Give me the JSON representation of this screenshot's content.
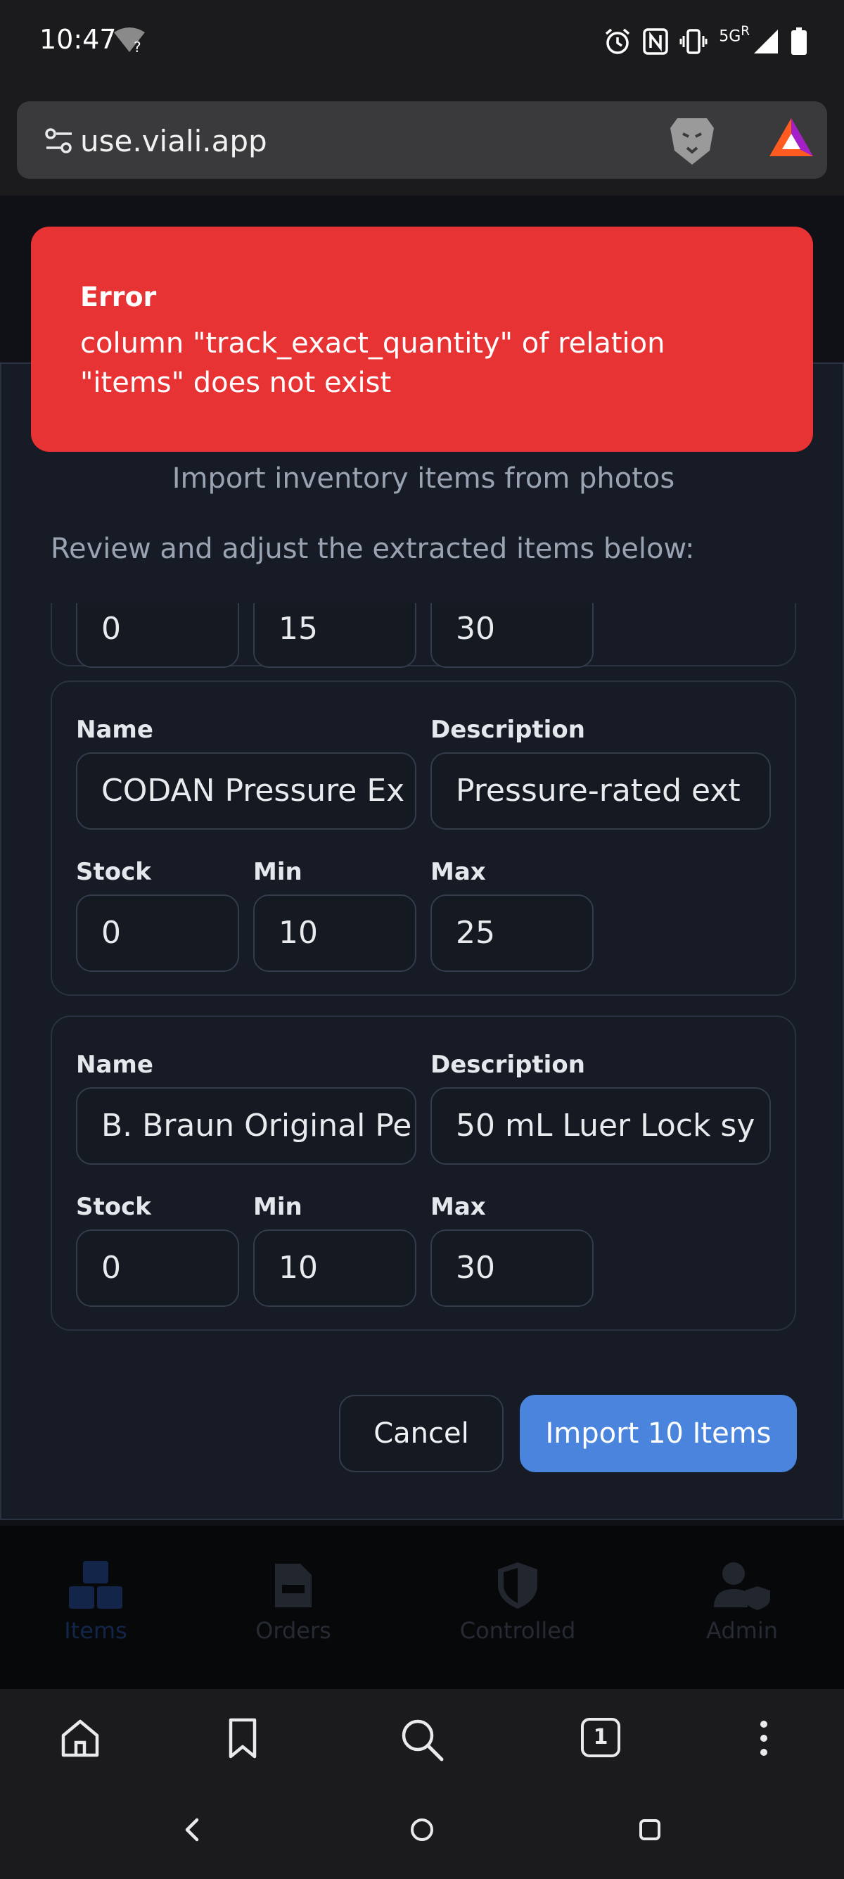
{
  "status_bar": {
    "time": "10:47",
    "network": "5G",
    "roaming": "R"
  },
  "browser": {
    "url": "use.viali.app",
    "tab_count": "1"
  },
  "toast": {
    "title": "Error",
    "message": "column \"track_exact_quantity\" of relation \"items\" does not exist",
    "color": "#e83335"
  },
  "modal": {
    "subtitle": "Import inventory items from photos",
    "hint": "Review and adjust the extracted items below:",
    "labels": {
      "name": "Name",
      "description": "Description",
      "stock": "Stock",
      "min": "Min",
      "max": "Max"
    },
    "items": [
      {
        "name": "",
        "description": "",
        "stock": "0",
        "min": "15",
        "max": "30"
      },
      {
        "name": "CODAN Pressure Ex",
        "description": "Pressure-rated ext",
        "stock": "0",
        "min": "10",
        "max": "25"
      },
      {
        "name": "B. Braun Original Pe",
        "description": "50 mL Luer Lock sy",
        "stock": "0",
        "min": "10",
        "max": "30"
      }
    ],
    "cancel_label": "Cancel",
    "import_label": "Import 10 Items",
    "accent": "#4a84dd"
  },
  "app_nav": {
    "items": [
      "Items",
      "Orders",
      "Controlled",
      "Admin"
    ],
    "active": "Items"
  }
}
